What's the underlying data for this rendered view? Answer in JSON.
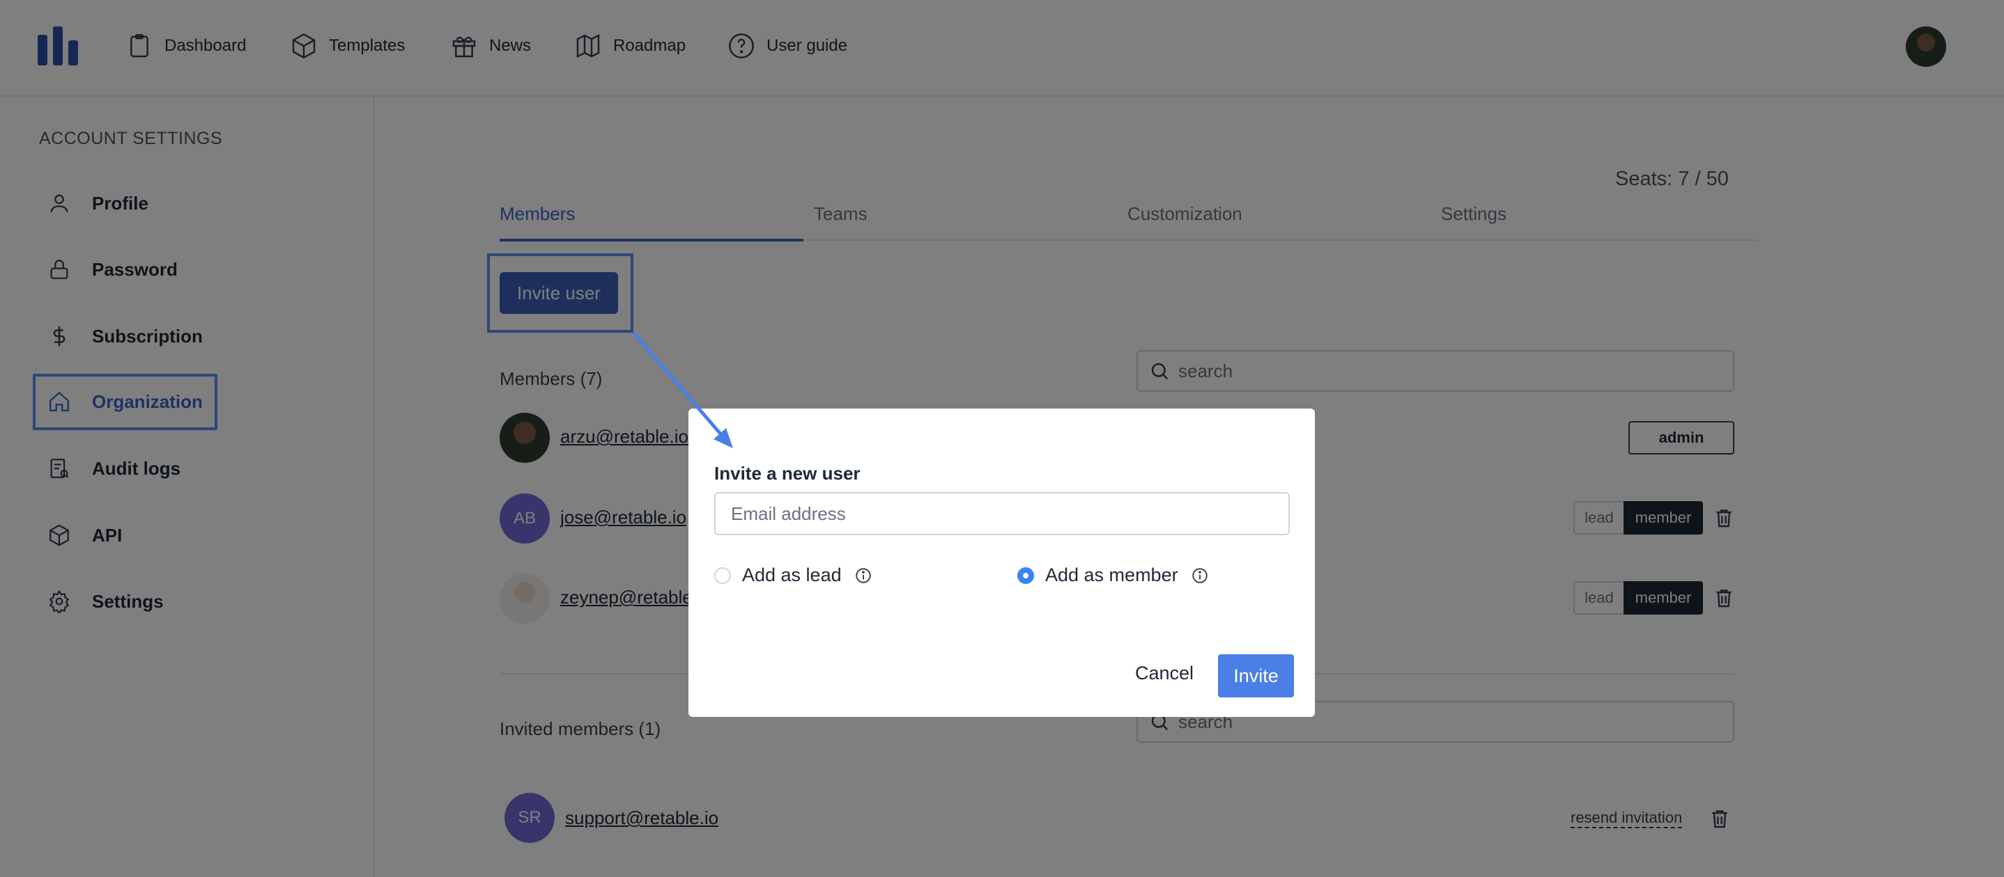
{
  "nav": {
    "items": [
      {
        "label": "Dashboard",
        "icon": "clipboard-icon"
      },
      {
        "label": "Templates",
        "icon": "cube-icon"
      },
      {
        "label": "News",
        "icon": "gift-icon"
      },
      {
        "label": "Roadmap",
        "icon": "map-icon"
      },
      {
        "label": "User guide",
        "icon": "question-circle-icon"
      }
    ]
  },
  "sidebar": {
    "heading": "ACCOUNT SETTINGS",
    "items": [
      {
        "label": "Profile",
        "icon": "user-icon"
      },
      {
        "label": "Password",
        "icon": "lock-icon"
      },
      {
        "label": "Subscription",
        "icon": "dollar-icon"
      },
      {
        "label": "Organization",
        "icon": "home-icon",
        "active": true
      },
      {
        "label": "Audit logs",
        "icon": "audit-log-icon"
      },
      {
        "label": "API",
        "icon": "cube-icon"
      },
      {
        "label": "Settings",
        "icon": "gear-icon"
      }
    ]
  },
  "main": {
    "seats": "Seats: 7 / 50",
    "tabs": [
      {
        "label": "Members",
        "active": true
      },
      {
        "label": "Teams"
      },
      {
        "label": "Customization"
      },
      {
        "label": "Settings"
      }
    ],
    "invite_button": "Invite user",
    "members_heading": "Members (7)",
    "search_placeholder": "search",
    "members": [
      {
        "email": "arzu@retable.io",
        "role": "admin"
      },
      {
        "email": "jose@retable.io",
        "initials": "AB",
        "role_options": [
          "lead",
          "member"
        ],
        "role": "member"
      },
      {
        "email": "zeynep@retable.io",
        "role_options": [
          "lead",
          "member"
        ],
        "role": "member"
      }
    ],
    "invited_heading": "Invited members (1)",
    "invited": [
      {
        "email": "support@retable.io",
        "initials": "SR",
        "action": "resend invitation"
      }
    ]
  },
  "modal": {
    "title": "Invite a new user",
    "email_placeholder": "Email address",
    "options": [
      {
        "label": "Add as lead",
        "checked": false
      },
      {
        "label": "Add as member",
        "checked": true
      }
    ],
    "cancel": "Cancel",
    "invite": "Invite"
  },
  "colors": {
    "accent": "#3b63c7",
    "button": "#3d5fb8",
    "highlight": "#5b8ef5",
    "avatar_purple": "#6f6bd9"
  }
}
